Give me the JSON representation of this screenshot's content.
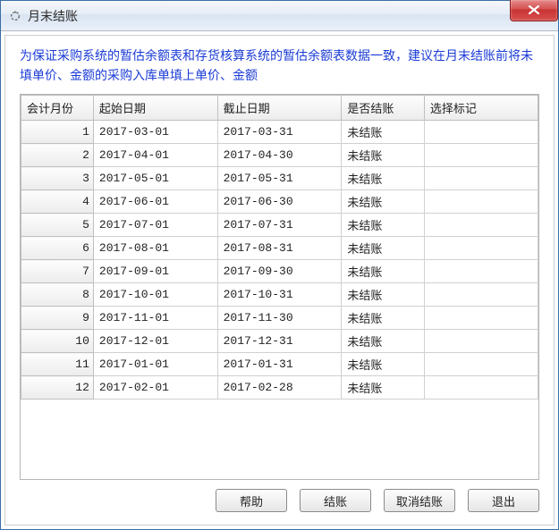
{
  "title": "月末结账",
  "instruction": "为保证采购系统的暂估余额表和存货核算系统的暂估余额表数据一致，建议在月末结账前将未填单价、金额的采购入库单填上单价、金额",
  "columns": {
    "month": "会计月份",
    "start": "起始日期",
    "end": "截止日期",
    "status": "是否结账",
    "mark": "选择标记"
  },
  "rows": [
    {
      "n": "1",
      "start": "2017-03-01",
      "end": "2017-03-31",
      "status": "未结账",
      "mark": ""
    },
    {
      "n": "2",
      "start": "2017-04-01",
      "end": "2017-04-30",
      "status": "未结账",
      "mark": ""
    },
    {
      "n": "3",
      "start": "2017-05-01",
      "end": "2017-05-31",
      "status": "未结账",
      "mark": ""
    },
    {
      "n": "4",
      "start": "2017-06-01",
      "end": "2017-06-30",
      "status": "未结账",
      "mark": ""
    },
    {
      "n": "5",
      "start": "2017-07-01",
      "end": "2017-07-31",
      "status": "未结账",
      "mark": ""
    },
    {
      "n": "6",
      "start": "2017-08-01",
      "end": "2017-08-31",
      "status": "未结账",
      "mark": ""
    },
    {
      "n": "7",
      "start": "2017-09-01",
      "end": "2017-09-30",
      "status": "未结账",
      "mark": ""
    },
    {
      "n": "8",
      "start": "2017-10-01",
      "end": "2017-10-31",
      "status": "未结账",
      "mark": ""
    },
    {
      "n": "9",
      "start": "2017-11-01",
      "end": "2017-11-30",
      "status": "未结账",
      "mark": ""
    },
    {
      "n": "10",
      "start": "2017-12-01",
      "end": "2017-12-31",
      "status": "未结账",
      "mark": ""
    },
    {
      "n": "11",
      "start": "2017-01-01",
      "end": "2017-01-31",
      "status": "未结账",
      "mark": ""
    },
    {
      "n": "12",
      "start": "2017-02-01",
      "end": "2017-02-28",
      "status": "未结账",
      "mark": ""
    }
  ],
  "buttons": {
    "help": "帮助",
    "close_account": "结账",
    "cancel_close": "取消结账",
    "exit": "退出"
  }
}
